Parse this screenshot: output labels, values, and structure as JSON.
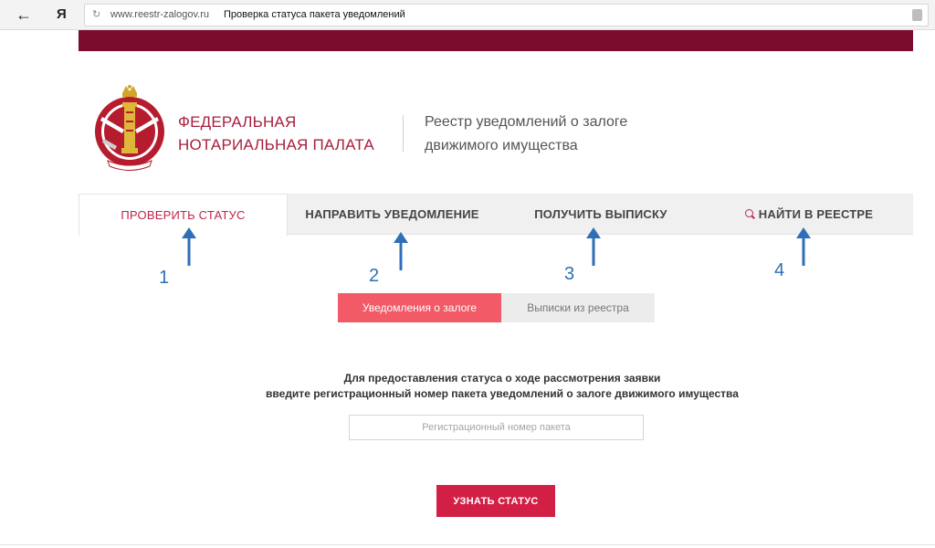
{
  "browser": {
    "back_icon": "arrow-left-icon",
    "logo": "Я",
    "url": "www.reestr-zalogov.ru",
    "page_title": "Проверка статуса пакета уведомлений"
  },
  "header": {
    "org_name_line1": "ФЕДЕРАЛЬНАЯ",
    "org_name_line2": "НОТАРИАЛЬНАЯ ПАЛАТА",
    "registry_line1": "Реестр уведомлений о залоге",
    "registry_line2": "движимого имущества",
    "emblem_icon": "notary-chamber-emblem"
  },
  "nav": {
    "tabs": [
      {
        "label": "ПРОВЕРИТЬ СТАТУС",
        "active": true
      },
      {
        "label": "НАПРАВИТЬ УВЕДОМЛЕНИЕ",
        "active": false
      },
      {
        "label": "ПОЛУЧИТЬ ВЫПИСКУ",
        "active": false
      },
      {
        "label": "НАЙТИ В РЕЕСТРЕ",
        "active": false,
        "icon": "search-icon"
      }
    ]
  },
  "annotations": [
    "1",
    "2",
    "3",
    "4"
  ],
  "subtabs": [
    {
      "label": "Уведомления о залоге",
      "active": true
    },
    {
      "label": "Выписки из реестра",
      "active": false
    }
  ],
  "form": {
    "instruction_line1": "Для предоставления статуса о ходе рассмотрения заявки",
    "instruction_line2": "введите регистрационный номер пакета уведомлений о залоге движимого имущества",
    "input_placeholder": "Регистрационный номер пакета",
    "input_value": "",
    "submit_label": "УЗНАТЬ СТАТУС"
  },
  "colors": {
    "brand_dark": "#7b0c2e",
    "brand_red": "#c2244a",
    "button_red": "#d21f46",
    "subtab_active": "#f15a66",
    "annotation_blue": "#2e6fb7"
  }
}
